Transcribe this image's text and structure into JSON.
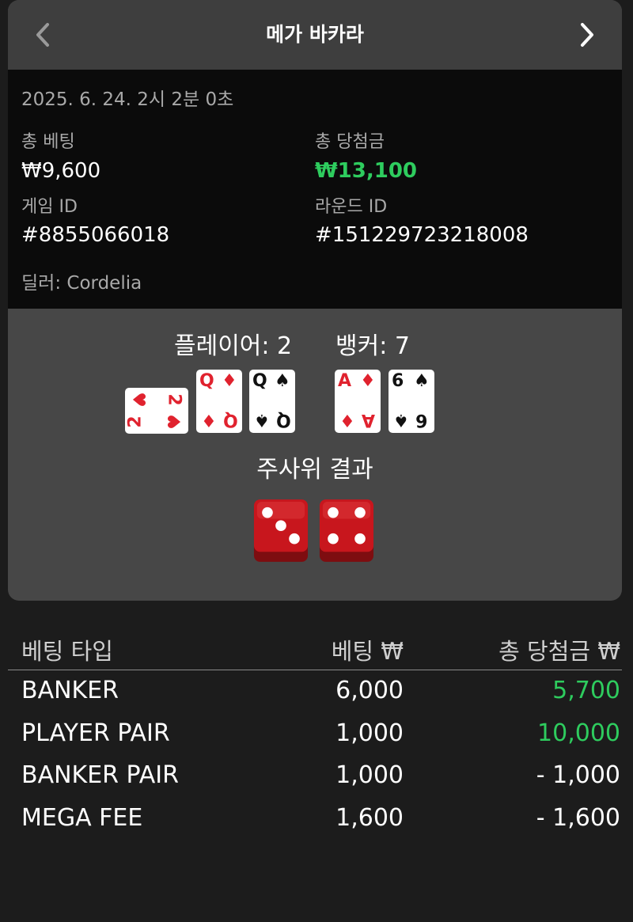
{
  "header": {
    "title": "메가 바카라",
    "back_icon": "chevron-left-icon",
    "next_icon": "chevron-right-icon"
  },
  "summary": {
    "date": "2025. 6. 24. 2시 2분 0초",
    "total_bet_label": "총 베팅",
    "total_bet_value": "₩9,600",
    "total_win_label": "총 당첨금",
    "total_win_value": "₩13,100",
    "game_id_label": "게임 ID",
    "game_id_value": "#8855066018",
    "round_id_label": "라운드 ID",
    "round_id_value": "#151229723218008",
    "dealer": "딜러: Cordelia"
  },
  "result": {
    "player_score": "플레이어: 2",
    "banker_score": "뱅커: 7",
    "player_cards": [
      {
        "rank": "2",
        "suit": "♥",
        "color": "#e0222e",
        "sideways": true
      },
      {
        "rank": "Q",
        "suit": "♦",
        "color": "#e0222e",
        "sideways": false
      },
      {
        "rank": "Q",
        "suit": "♠",
        "color": "#111111",
        "sideways": false
      }
    ],
    "banker_cards": [
      {
        "rank": "A",
        "suit": "♦",
        "color": "#e0222e",
        "sideways": false
      },
      {
        "rank": "6",
        "suit": "♠",
        "color": "#111111",
        "sideways": false
      }
    ],
    "dice_title": "주사위 결과",
    "dice": [
      3,
      4
    ],
    "dice_color": "#c8161d"
  },
  "bets": {
    "headers": [
      "베팅 타입",
      "베팅 ₩",
      "총 당첨금 ₩"
    ],
    "rows": [
      {
        "type": "BANKER",
        "bet": "6,000",
        "payout": "5,700",
        "win": true
      },
      {
        "type": "PLAYER PAIR",
        "bet": "1,000",
        "payout": "10,000",
        "win": true
      },
      {
        "type": "BANKER PAIR",
        "bet": "1,000",
        "payout": "- 1,000",
        "win": false
      },
      {
        "type": "MEGA FEE",
        "bet": "1,600",
        "payout": "- 1,600",
        "win": false
      }
    ]
  }
}
